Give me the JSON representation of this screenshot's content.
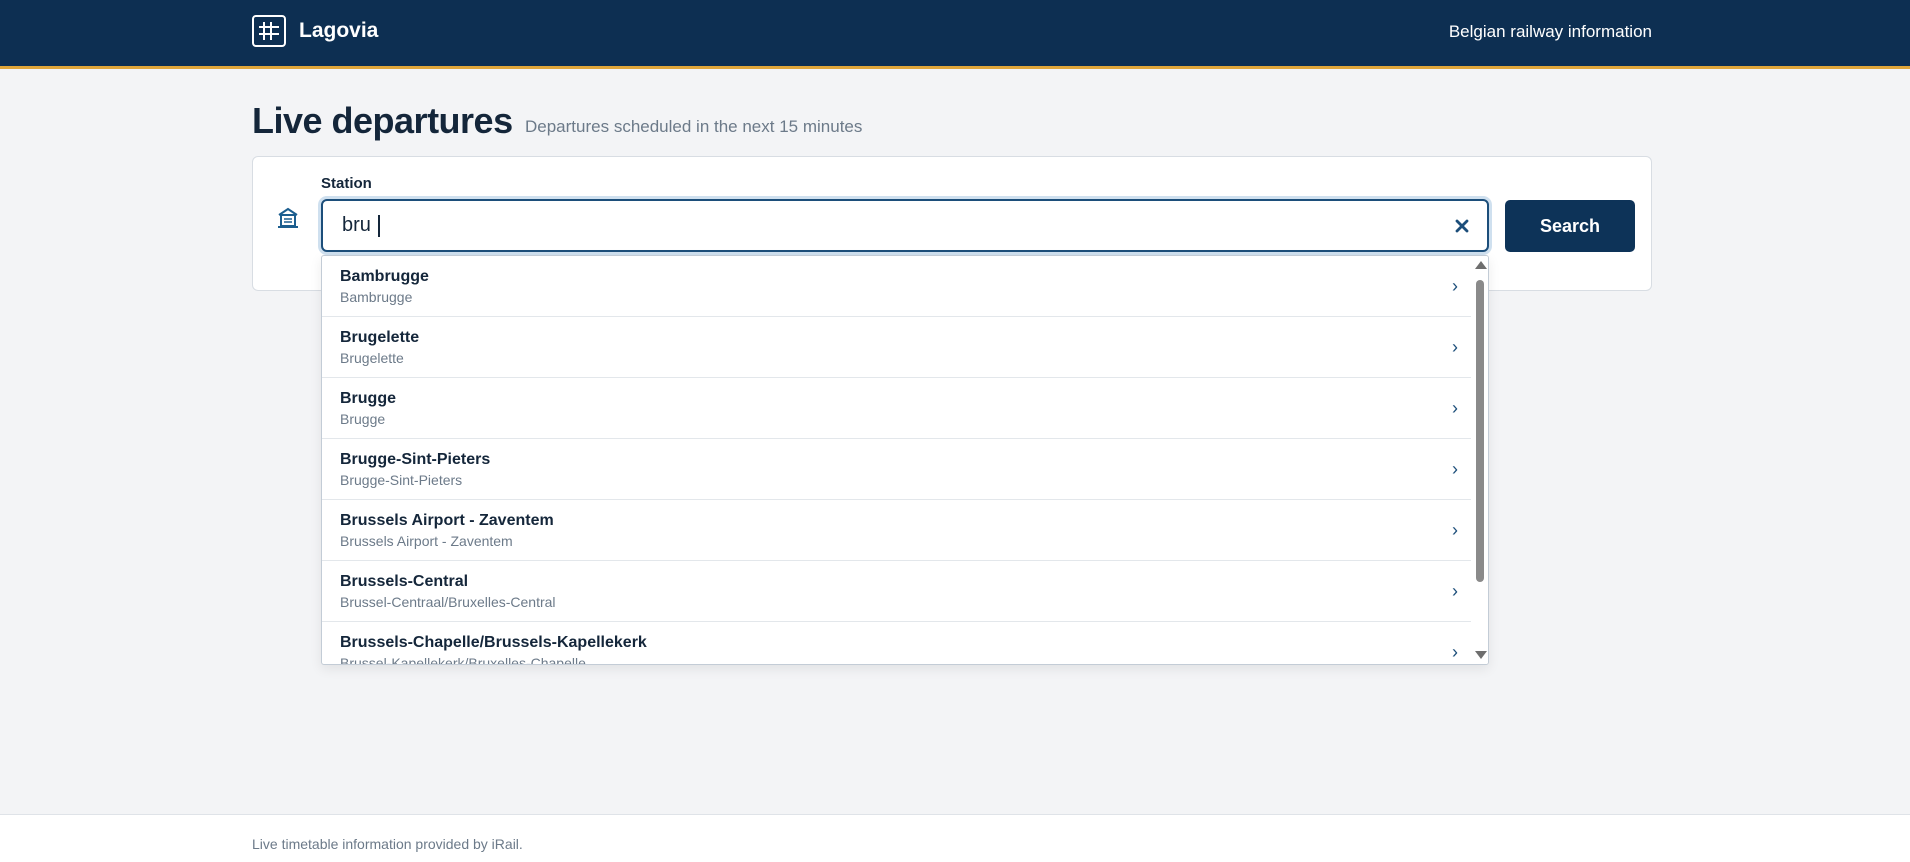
{
  "header": {
    "brand": "Lagovia",
    "tagline": "Belgian railway information"
  },
  "page": {
    "title": "Live departures",
    "subtitle": "Departures scheduled in the next 15 minutes"
  },
  "search": {
    "label": "Station",
    "value": "bru",
    "button_label": "Search",
    "icon": "station-icon",
    "clear_icon": "close-icon"
  },
  "suggestions": [
    {
      "name": "Bambrugge",
      "sub": "Bambrugge"
    },
    {
      "name": "Brugelette",
      "sub": "Brugelette"
    },
    {
      "name": "Brugge",
      "sub": "Brugge"
    },
    {
      "name": "Brugge-Sint-Pieters",
      "sub": "Brugge-Sint-Pieters"
    },
    {
      "name": "Brussels Airport - Zaventem",
      "sub": "Brussels Airport - Zaventem"
    },
    {
      "name": "Brussels-Central",
      "sub": "Brussel-Centraal/Bruxelles-Central"
    },
    {
      "name": "Brussels-Chapelle/Brussels-Kapellekerk",
      "sub": "Brussel-Kapellekerk/Bruxelles-Chapelle"
    }
  ],
  "footer": {
    "text": "Live timetable information provided by iRail."
  },
  "colors": {
    "header_bg": "#0d2f52",
    "accent_line": "#e0a63a",
    "button_bg": "#0d3358"
  }
}
